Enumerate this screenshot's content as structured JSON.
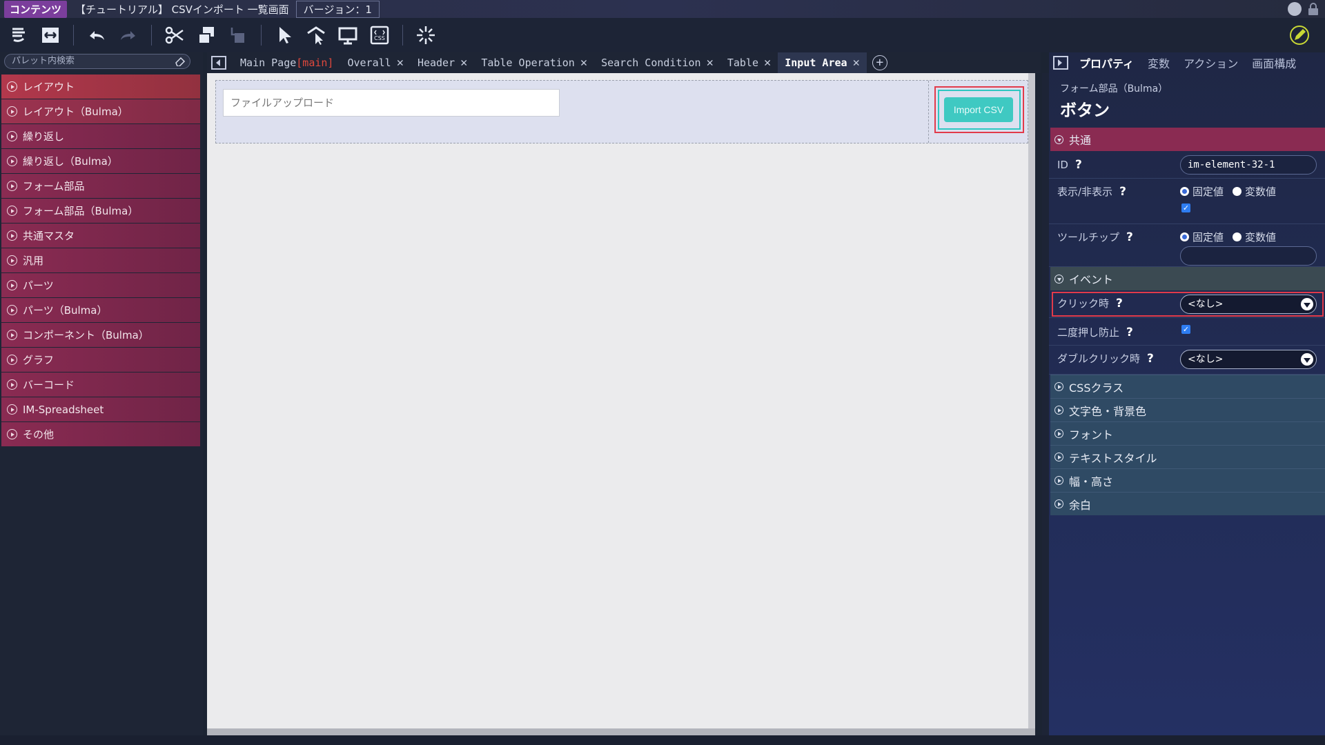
{
  "titlebar": {
    "badge": "コンテンツ",
    "title": "【チュートリアル】 CSVインポート 一覧画面",
    "version": "バージョン：1"
  },
  "palette": {
    "search_placeholder": "パレット内検索",
    "items": [
      {
        "label": "レイアウト"
      },
      {
        "label": "レイアウト（Bulma）"
      },
      {
        "label": "繰り返し"
      },
      {
        "label": "繰り返し（Bulma）"
      },
      {
        "label": "フォーム部品"
      },
      {
        "label": "フォーム部品（Bulma）"
      },
      {
        "label": "共通マスタ"
      },
      {
        "label": "汎用"
      },
      {
        "label": "パーツ"
      },
      {
        "label": "パーツ（Bulma）"
      },
      {
        "label": "コンポーネント（Bulma）"
      },
      {
        "label": "グラフ"
      },
      {
        "label": "バーコード"
      },
      {
        "label": "IM-Spreadsheet"
      },
      {
        "label": "その他"
      }
    ]
  },
  "tabs": {
    "main": {
      "label": "Main Page",
      "tag": "[main]"
    },
    "items": [
      {
        "label": "Overall",
        "close": "✕"
      },
      {
        "label": "Header",
        "close": "✕"
      },
      {
        "label": "Table Operation",
        "close": "✕"
      },
      {
        "label": "Search Condition",
        "close": "✕"
      },
      {
        "label": "Table",
        "close": "✕"
      },
      {
        "label": "Input Area",
        "close": "✕",
        "active": true
      }
    ],
    "add": "+"
  },
  "canvas": {
    "file_upload_placeholder": "ファイルアップロード",
    "import_button": "Import CSV"
  },
  "properties": {
    "tabs": [
      "プロパティ",
      "変数",
      "アクション",
      "画面構成"
    ],
    "category": "フォーム部品（Bulma）",
    "title": "ボタン",
    "sections": {
      "common": "共通",
      "event": "イベント",
      "closed": [
        "CSSクラス",
        "文字色・背景色",
        "フォント",
        "テキストスタイル",
        "幅・高さ",
        "余白"
      ]
    },
    "rows": {
      "id_label": "ID",
      "id_value": "im-element-32-1",
      "visibility_label": "表示/非表示",
      "tooltip_label": "ツールチップ",
      "fixed_label": "固定値",
      "variable_label": "変数値",
      "click_label": "クリック時",
      "click_value": "<なし>",
      "double_submit_label": "二度押し防止",
      "dblclick_label": "ダブルクリック時",
      "dblclick_value": "<なし>"
    },
    "help": "?"
  },
  "colors": {
    "accent_red": "#e23a4a",
    "button_teal": "#3fc9c2",
    "palette_item": "#8a2b52"
  }
}
